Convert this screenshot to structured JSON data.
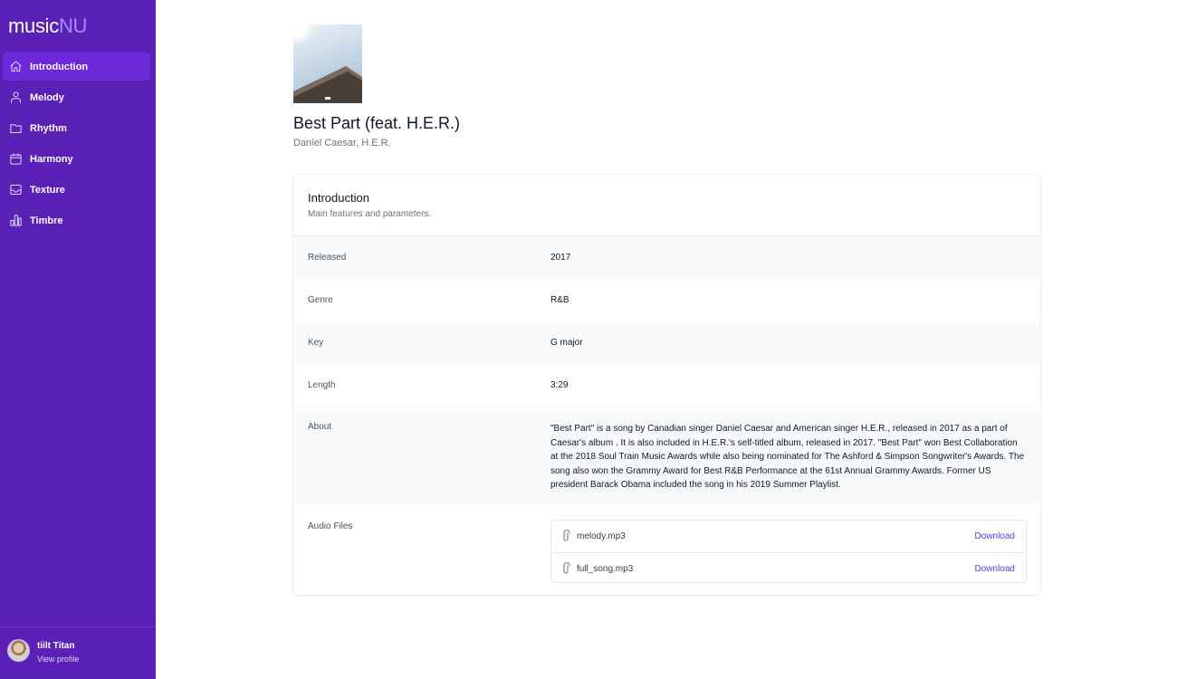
{
  "sidebar": {
    "logo_part1": "music",
    "logo_part2": "NU",
    "items": [
      {
        "label": "Introduction",
        "icon": "home-icon",
        "active": true
      },
      {
        "label": "Melody",
        "icon": "users-icon"
      },
      {
        "label": "Rhythm",
        "icon": "folder-icon"
      },
      {
        "label": "Harmony",
        "icon": "calendar-icon"
      },
      {
        "label": "Texture",
        "icon": "inbox-icon"
      },
      {
        "label": "Timbre",
        "icon": "bar-chart-icon"
      }
    ],
    "profile": {
      "name": "tiilt Titan",
      "link": "View profile"
    }
  },
  "song": {
    "title": "Best Part (feat. H.E.R.)",
    "artist": "Daniel Caesar, H.E.R."
  },
  "card": {
    "title": "Introduction",
    "subtitle": "Main features and parameters.",
    "rows": [
      {
        "label": "Released",
        "value": "2017"
      },
      {
        "label": "Genre",
        "value": "R&B"
      },
      {
        "label": "Key",
        "value": "G major"
      },
      {
        "label": "Length",
        "value": "3:29"
      },
      {
        "label": "About",
        "value": "\"Best Part\" is a song by Canadian singer Daniel Caesar and American singer H.E.R., released in 2017 as a part of Caesar's album . It is also included in H.E.R.'s self-titled album, released in 2017. \"Best Part\" won Best Collaboration at the 2018 Soul Train Music Awards while also being nominated for The Ashford & Simpson Songwriter's Awards. The song also won the Grammy Award for Best R&B Performance at the 61st Annual Grammy Awards. Former US president Barack Obama included the song in his 2019 Summer Playlist."
      }
    ],
    "audio_label": "Audio Files",
    "files": [
      {
        "name": "melody.mp3",
        "action": "Download"
      },
      {
        "name": "full_song.mp3",
        "action": "Download"
      }
    ]
  },
  "colors": {
    "sidebar": "#5b21b6",
    "active": "#6d28d9",
    "link": "#4f46e5"
  }
}
